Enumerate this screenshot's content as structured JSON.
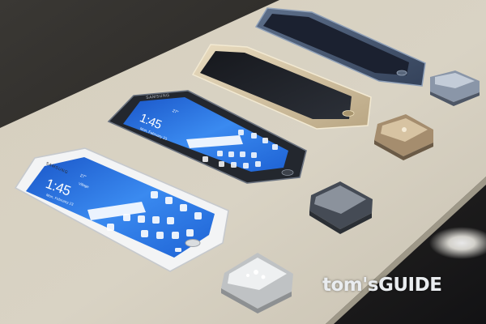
{
  "phones": [
    {
      "id": "front-white",
      "brand": "SAMSUNG",
      "time": "1:45",
      "date": "Mon, February 23",
      "weather": "27°",
      "city": "Village"
    },
    {
      "id": "middle-black",
      "brand": "SAMSUNG",
      "time": "1:45",
      "date": "Mon, February 23",
      "weather": "27°"
    }
  ],
  "watermark": {
    "text": "tom'sGUIDE"
  },
  "colors": {
    "table": "#d9d3c3",
    "screen_blue": "#2f7fe0",
    "background": "#1a1a1c"
  },
  "icons": [
    "google-search-bar",
    "app-icon",
    "home-button",
    "chip-display-block"
  ]
}
